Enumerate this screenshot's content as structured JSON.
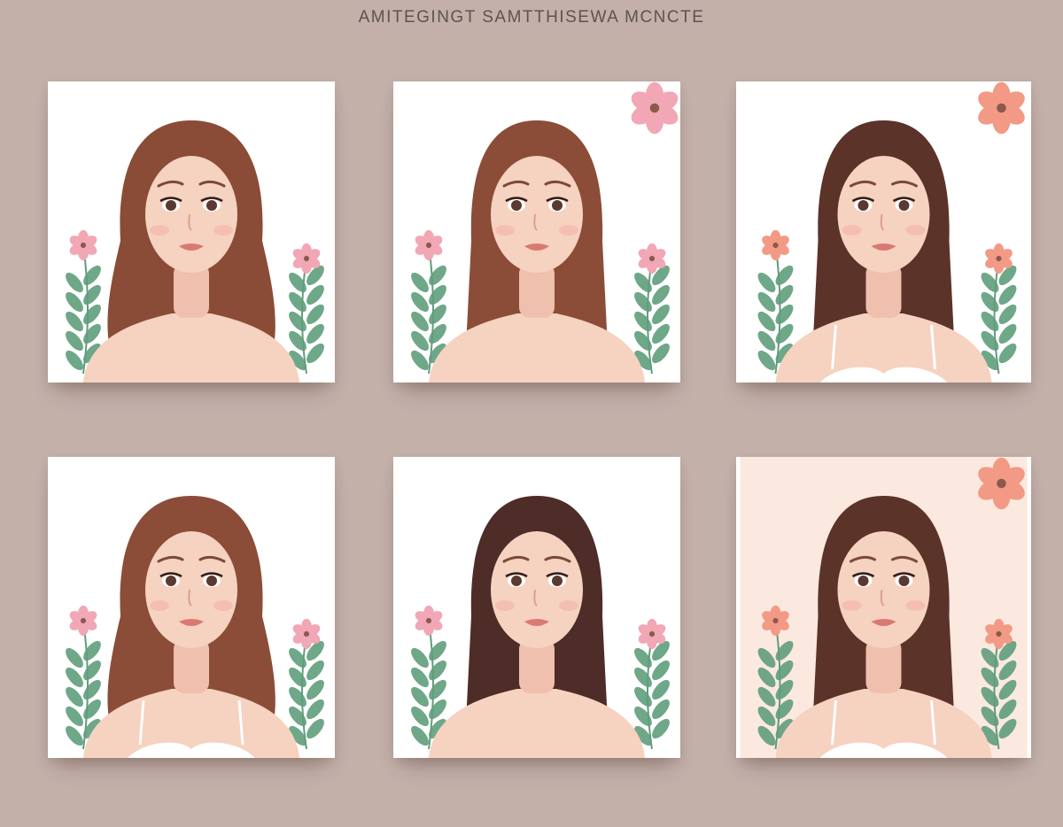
{
  "header": {
    "title": "AMITEGINGT SAMTTHISEWA MCNCTE"
  },
  "palette": {
    "background": "#c3b0a9",
    "card": "#ffffff",
    "skin": "#f6d2c0",
    "leaf": "#5f9d7c",
    "flower_pink": "#f1a7b6",
    "flower_coral": "#f29a85"
  },
  "portraits": [
    {
      "hair": "#8a4c36",
      "hair_style": "wavy",
      "flowers": "pink",
      "strap": false
    },
    {
      "hair": "#8b4d38",
      "hair_style": "straight",
      "flowers": "pink",
      "strap": false
    },
    {
      "hair": "#5b3329",
      "hair_style": "straight",
      "flowers": "coral",
      "strap": true
    },
    {
      "hair": "#8b4d38",
      "hair_style": "wavy",
      "flowers": "pink",
      "strap": true
    },
    {
      "hair": "#4e2c27",
      "hair_style": "straight",
      "flowers": "pink",
      "strap": false
    },
    {
      "hair": "#5b3329",
      "hair_style": "straight",
      "flowers": "coral",
      "strap": true
    }
  ]
}
